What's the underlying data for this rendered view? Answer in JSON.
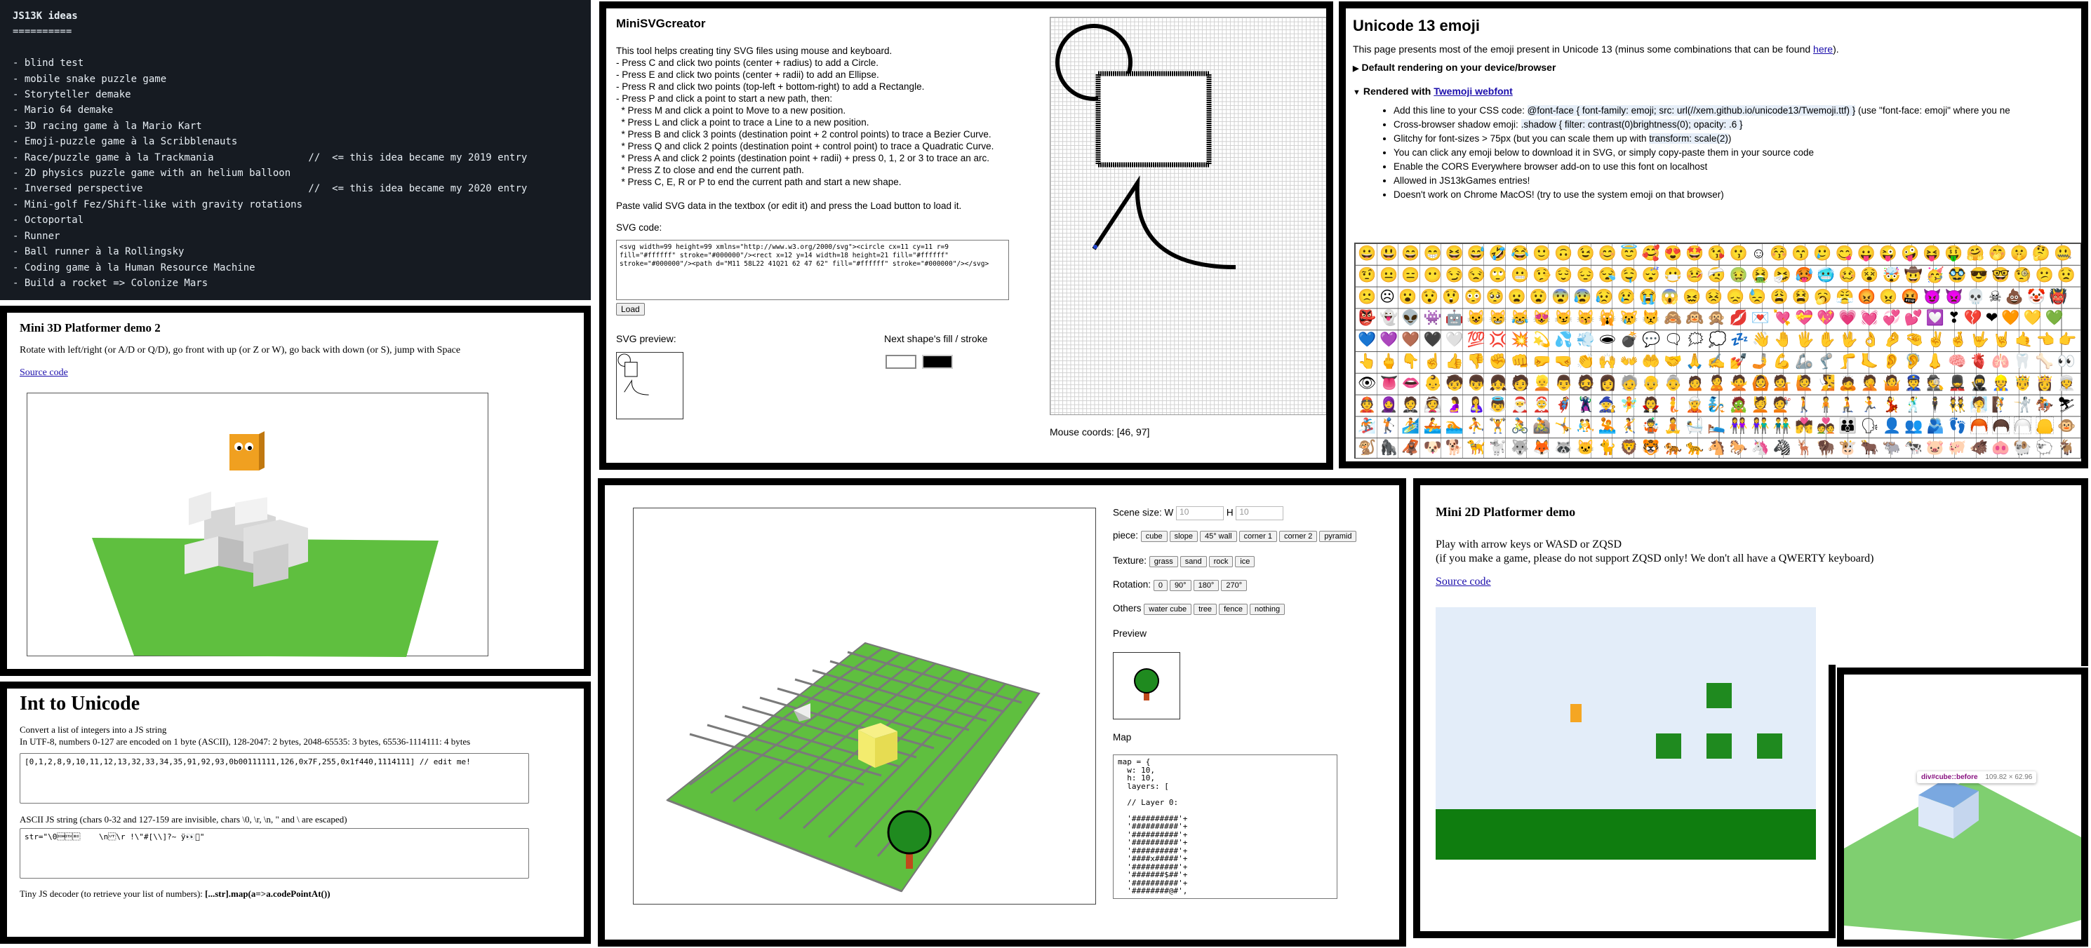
{
  "ideas": {
    "title": "JS13K ideas",
    "underline": "==========",
    "items": [
      "- blind test",
      "- mobile snake puzzle game",
      "- Storyteller demake",
      "- Mario 64 demake",
      "- 3D racing game à la Mario Kart",
      "- Emoji-puzzle game à la Scribblenauts",
      "- Race/puzzle game à la Trackmania                //  <= this idea became my 2019 entry",
      "- 2D physics puzzle game with an helium balloon",
      "- Inversed perspective                            //  <= this idea became my 2020 entry",
      "- Mini-golf Fez/Shift-like with gravity rotations",
      "- Octoportal",
      "- Runner",
      "- Ball runner à la Rollingsky",
      "- Coding game à la Human Resource Machine",
      "- Build a rocket => Colonize Mars"
    ]
  },
  "platformer3d": {
    "title": "Mini 3D Platformer demo 2",
    "desc": "Rotate with left/right (or A/D or Q/D), go front with up (or Z or W), go back with down (or S), jump with Space",
    "source": "Source code"
  },
  "unicode": {
    "title": "Int to Unicode",
    "line1": "Convert a list of integers into a JS string",
    "line2": "In UTF-8, numbers 0-127 are encoded on 1 byte (ASCII), 128-2047: 2 bytes, 2048-65535: 3 bytes, 65536-1114111: 4 bytes",
    "input": "[0,1,2,8,9,10,11,12,13,32,33,34,35,91,92,93,0b00111111,126,0x7F,255,0x1f440,1114111] // edit me!",
    "ascii_label": "ASCII JS string (chars 0-32 and 127-159 are invisible, chars \\0, \\r, \\n, \" and \\ are escaped)",
    "output": "str=\"\\0\u0001\u0002\b\t\\n\u000b\f\\r !\\\"#[\\\\]?~ ÿ👀􏿿\"",
    "decoder_label": "Tiny JS decoder (to retrieve your list of numbers):",
    "decoder_code": "[...str].map(a=>a.codePointAt())"
  },
  "svg": {
    "title": "MiniSVGcreator",
    "lines": [
      "This tool helps creating tiny SVG files using mouse and keyboard.",
      "- Press C and click two points (center + radius) to add a Circle.",
      "- Press E and click two points (center + radii) to add an Ellipse.",
      "- Press R and click two points (top-left + bottom-right) to add a Rectangle.",
      "- Press P and click a point to start a new path, then:",
      "  * Press M and click a point to Move to a new position.",
      "  * Press L and click a point to trace a Line to a new position.",
      "  * Press B and click 3 points (destination point + 2 control points) to trace a Bezier Curve.",
      "  * Press Q and click 2 points (destination point + control point) to trace a Quadratic Curve.",
      "  * Press A and click 2 points (destination point + radii) + press 0, 1, 2 or 3 to trace an arc.",
      "  * Press Z to close and end the current path.",
      "  * Press C, E, R or P to end the current path and start a new shape."
    ],
    "paste_info": "Paste valid SVG data in the textbox (or edit it) and press the Load button to load it.",
    "code_label": "SVG code:",
    "code": "<svg width=99 height=99 xmlns=\"http://www.w3.org/2000/svg\"><circle cx=11 cy=11 r=9 fill=\"#ffffff\" stroke=\"#000000\"/><rect x=12 y=14 width=18 height=21 fill=\"#ffffff\" stroke=\"#000000\"/><path d=\"M11 58L22 41Q21 62 47 62\" fill=\"#ffffff\" stroke=\"#000000\"/></svg>",
    "load": "Load",
    "preview_label": "SVG preview:",
    "fill_label": "Next shape's fill / stroke",
    "fill_color": "#ffffff",
    "stroke_color": "#000000",
    "coords": "Mouse coords: [46, 97]"
  },
  "emoji": {
    "title": "Unicode 13 emoji",
    "intro": "This page presents most of the emoji present in Unicode 13 (minus some combinations that can be found ",
    "intro_link": "here",
    "intro_end": ").",
    "details1": "Default rendering on your device/browser",
    "details2_prefix": "Rendered with ",
    "details2_link": "Twemoji webfont",
    "b1_pre": "Add this line to your CSS code: ",
    "b1_code": "@font-face { font-family: emoji; src: url(//xem.github.io/unicode13/Twemoji.ttf) }",
    "b1_post": " (use \"font-face: emoji\" where you ne",
    "b2_pre": "Cross-browser shadow emoji: ",
    "b2_code": ".shadow { filter: contrast(0)brightness(0); opacity: .6 }",
    "b3_pre": "Glitchy for font-sizes > 75px (but you can scale them up with ",
    "b3_code": "transform: scale(2)",
    "b3_post": ")",
    "b4": "You can click any emoji below to download it in SVG, or simply copy-paste them in your source code",
    "b5": "Enable the CORS Everywhere browser add-on to use this font on localhost",
    "b6": "Allowed in JS13kGames entries!",
    "b7": "Doesn't work on Chrome MacOS! (try to use the system emoji on that browser)",
    "grid": "😀😃😄😁😆😅🤣😂🙂🙃😉😊😇🥰😍🤩😘😗☺😚😙🥲😋😛😜🤪😝🤑🤗🤭🤫🤔🤐🤨😐😑😶😏😒🙄😬🤥😌😔😪🤤😴😷🤒🤕🤢🤮🤧🥵🥶🥴😵🤯🤠🥳🥸😎🤓🧐😕😟🙁☹😮😯😲😳🥺😦😧😨😰😥😢😭😱😖😣😞😓😩😫🥱😤😡😠🤬😈👿💀☠💩🤡👹👺👻👽👾🤖😺😸😹😻😼😽🙀😿😾🙈🙉🙊💋💌💘💝💖💗💓💞💕💟❣💔❤🧡💛💚💙💜🤎🖤🤍💯💢💥💫💦💨🕳💣💬🗨🗯💭💤👋🤚🖐✋🖖👌🤌🤏✌🤞🤟🤘🤙👈👉👆🖕👇☝👍👎✊👊🤛🤜👏🙌👐🤲🤝🙏✍💅🤳💪🦾🦿🦵🦶👂🦻👃🧠🫀🫁🦷🦴👀👁👅👄👶🧒👦👧🧑👱👨🧔👩🧓👴👵🙍🙎🙅🙆💁🙋🧏🙇🤦🤷👮🕵💂🥷👷🤴👸👳👲🧕🤵👰🤰🤱👼🎅🤶🦸🦹🧙🧚🧛🧜🧝🧞🧟💆💇🚶🧍🧎🏃💃🕺🕴👯🧖🧗🤺🏇⛷🏂🏌🏄🚣🏊⛹🏋🚴🚵🤸🤼🤽🤾🤹🧘🛀🛌👭👫👬💏💑👪🗣👤👥🫂👣🦰🦱🦳🦲🐵🐒🦍🦧🐶🐕🦮🐩🐺🦊🦝🐱🐈🦁🐯🐅🐆🐴🐎🦄🦓🦌🦬🐮🐂🐃🐄🐷🐖🐗🐽🐏🐑🐐🐪🐫🦙🦒🐘🦣🦏🦛🐭🐁🐀🐹🐰🐇🐿🦫🦔🦇🐻🐨🐼🦥🦦🦨🦘🦡🐾🦃🐔🐓🐣🐤🐥🐦🐧🕊🦅🦆🦢🦉🦤🪶🦩🦚🦜🐸🐊🐢🦎🐍🐲🐉🦕🦖🐳🐋🐬🦭🐟🐠🐡🦈🐙🐚🐌🦋🐛🐜🐝🪲🐞🦗🪳🕷🕸🦂🦟🪰🪱🦠💐🌸💮🏵🌹🥀🌺🌻🌼🌷🌱🪴🌲🌳🌴🌵🌾🌿☘🍀🍁🍂🍃"
  },
  "editor": {
    "scene_label": "Scene size: W",
    "w_placeholder": "10",
    "h_label": "H",
    "h_placeholder": "10",
    "piece_label": "piece:",
    "pieces": [
      "cube",
      "slope",
      "45° wall",
      "corner 1",
      "corner 2",
      "pyramid"
    ],
    "texture_label": "Texture:",
    "textures": [
      "grass",
      "sand",
      "rock",
      "ice"
    ],
    "rotation_label": "Rotation:",
    "rotations": [
      "0",
      "90°",
      "180°",
      "270°"
    ],
    "others_label": "Others",
    "others": [
      "water cube",
      "tree",
      "fence",
      "nothing"
    ],
    "preview_label": "Preview",
    "map_label": "Map",
    "map_code": "map = {\n  w: 10,\n  h: 10,\n  layers: [\n\n  // Layer 0:\n\n  '##########'+\n  '##########'+\n  '##########'+\n  '##########'+\n  '##########'+\n  '####x#####'+\n  '##########'+\n  '#######$##'+\n  '##########'+\n  '########@#',\n\n  ''"
  },
  "platformer2d": {
    "title": "Mini 2D Platformer demo",
    "line1": "Play with arrow keys or WASD or ZQSD",
    "line2": "(if you make a game, please do not support ZQSD only! We don't all have a QWERTY keyboard)",
    "source": "Source code"
  },
  "cube": {
    "tooltip_name": "div#cube::before",
    "tooltip_size": "109.82 × 62.96"
  },
  "colors": {
    "grass": "#5fbf3f",
    "platform_green": "#1f8a1f",
    "player_orange": "#f5a623",
    "sky": "#e3edf9"
  }
}
